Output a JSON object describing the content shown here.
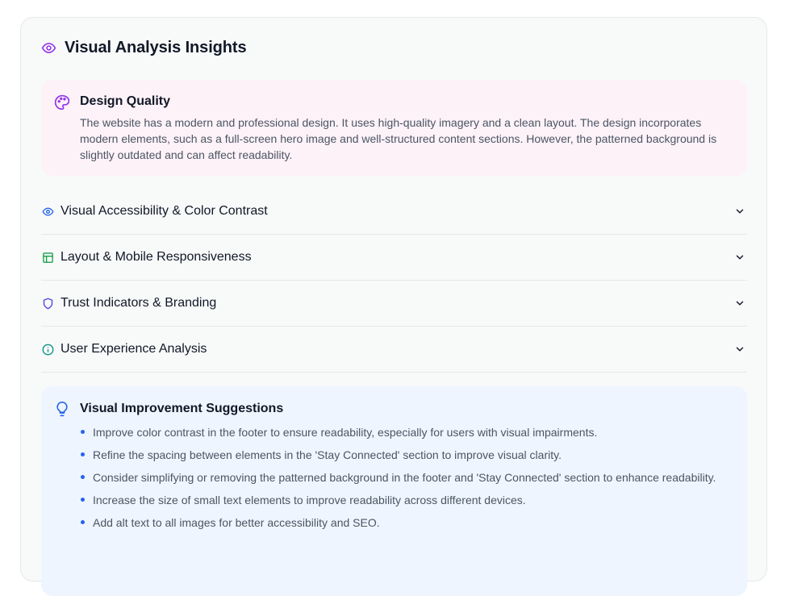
{
  "header": {
    "title": "Visual Analysis Insights",
    "icon": "eye-icon",
    "icon_color": "#9333ea"
  },
  "design_quality": {
    "title": "Design Quality",
    "icon": "palette-icon",
    "icon_color": "#9333ea",
    "background": "#fdf2f8",
    "text": "The website has a modern and professional design. It uses high-quality imagery and a clean layout. The design incorporates modern elements, such as a full-screen hero image and well-structured content sections. However, the patterned background is slightly outdated and can affect readability."
  },
  "accordion": [
    {
      "label": "Visual Accessibility & Color Contrast",
      "icon": "eye-icon",
      "icon_color": "#2563eb",
      "expanded": false
    },
    {
      "label": "Layout & Mobile Responsiveness",
      "icon": "layout-icon",
      "icon_color": "#16a34a",
      "expanded": false
    },
    {
      "label": "Trust Indicators & Branding",
      "icon": "shield-icon",
      "icon_color": "#4f46e5",
      "expanded": false
    },
    {
      "label": "User Experience Analysis",
      "icon": "info-icon",
      "icon_color": "#0d9488",
      "expanded": false
    }
  ],
  "suggestions": {
    "title": "Visual Improvement Suggestions",
    "icon": "lightbulb-icon",
    "icon_color": "#2563eb",
    "background": "#eef5fe",
    "items": [
      "Improve color contrast in the footer to ensure readability, especially for users with visual impairments.",
      "Refine the spacing between elements in the 'Stay Connected' section to improve visual clarity.",
      "Consider simplifying or removing the patterned background in the footer and 'Stay Connected' section to enhance readability.",
      "Increase the size of small text elements to improve readability across different devices.",
      "Add alt text to all images for better accessibility and SEO."
    ]
  }
}
